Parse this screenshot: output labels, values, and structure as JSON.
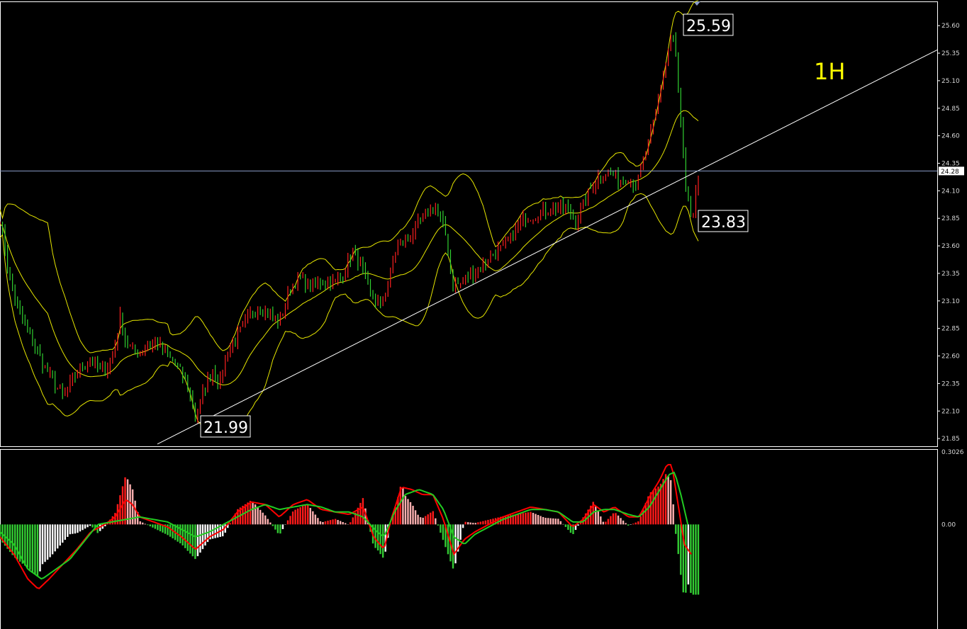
{
  "chart_data": {
    "type": "candlestick",
    "timeframe_label": "1H",
    "price_axis": {
      "ylim": [
        21.78,
        25.82
      ],
      "ticks": [
        "25.60",
        "25.35",
        "25.10",
        "24.85",
        "24.60",
        "24.35",
        "24.10",
        "23.85",
        "23.60",
        "23.35",
        "23.10",
        "22.85",
        "22.60",
        "22.35",
        "22.10",
        "21.85"
      ],
      "current_price_label": "24.28",
      "current_price": 24.28
    },
    "indicator_axis": {
      "ylim": [
        -0.42,
        0.3026
      ],
      "ticks": [
        "0.3026",
        "0.00"
      ],
      "zero_label": "0.00",
      "top_label": "0.3026"
    },
    "annotations": {
      "high": {
        "text": "25.59",
        "value": 25.59
      },
      "low": {
        "text": "21.99",
        "value": 21.99
      },
      "last": {
        "text": "23.83",
        "value": 23.83
      }
    },
    "bars_count": 280,
    "trendline": {
      "from": [
        0.163,
        21.8
      ],
      "to": [
        0.97,
        25.38
      ]
    },
    "colors": {
      "background": "#000000",
      "up": "#ff2020",
      "down": "#30d030",
      "bands": "#e6e600",
      "trendline": "#ffffff",
      "price_line": "#8a9bc8",
      "macd_line": "#ff0000",
      "signal_line": "#22cc22",
      "hist_pos_strong": "#ff1a1a",
      "hist_pos_weak": "#ffb0b0",
      "hist_neg_strong": "#33cc33",
      "hist_neg_weak": "#ffffff"
    },
    "price_path": [
      [
        0,
        23.85
      ],
      [
        0.006,
        23.62
      ],
      [
        0.015,
        23.25
      ],
      [
        0.03,
        22.95
      ],
      [
        0.045,
        22.75
      ],
      [
        0.06,
        22.55
      ],
      [
        0.075,
        22.38
      ],
      [
        0.09,
        22.22
      ],
      [
        0.102,
        22.35
      ],
      [
        0.115,
        22.5
      ],
      [
        0.13,
        22.55
      ],
      [
        0.145,
        22.45
      ],
      [
        0.16,
        22.55
      ],
      [
        0.172,
        22.95
      ],
      [
        0.18,
        22.72
      ],
      [
        0.195,
        22.62
      ],
      [
        0.21,
        22.7
      ],
      [
        0.225,
        22.72
      ],
      [
        0.24,
        22.6
      ],
      [
        0.255,
        22.5
      ],
      [
        0.27,
        22.3
      ],
      [
        0.28,
        22.02
      ],
      [
        0.292,
        22.3
      ],
      [
        0.305,
        22.48
      ],
      [
        0.315,
        22.35
      ],
      [
        0.325,
        22.62
      ],
      [
        0.34,
        22.78
      ],
      [
        0.355,
        22.95
      ],
      [
        0.37,
        23.05
      ],
      [
        0.385,
        22.98
      ],
      [
        0.4,
        22.9
      ],
      [
        0.415,
        23.2
      ],
      [
        0.43,
        23.32
      ],
      [
        0.445,
        23.22
      ],
      [
        0.46,
        23.28
      ],
      [
        0.475,
        23.25
      ],
      [
        0.49,
        23.32
      ],
      [
        0.505,
        23.55
      ],
      [
        0.518,
        23.4
      ],
      [
        0.53,
        23.15
      ],
      [
        0.545,
        23.05
      ],
      [
        0.555,
        23.25
      ],
      [
        0.568,
        23.6
      ],
      [
        0.58,
        23.65
      ],
      [
        0.595,
        23.75
      ],
      [
        0.61,
        23.9
      ],
      [
        0.625,
        23.95
      ],
      [
        0.638,
        23.7
      ],
      [
        0.648,
        23.25
      ],
      [
        0.66,
        23.25
      ],
      [
        0.675,
        23.35
      ],
      [
        0.69,
        23.42
      ],
      [
        0.705,
        23.52
      ],
      [
        0.72,
        23.58
      ],
      [
        0.735,
        23.7
      ],
      [
        0.75,
        23.85
      ],
      [
        0.765,
        23.88
      ],
      [
        0.78,
        23.92
      ],
      [
        0.795,
        23.95
      ],
      [
        0.81,
        23.95
      ],
      [
        0.825,
        23.82
      ],
      [
        0.84,
        24.05
      ],
      [
        0.855,
        24.22
      ],
      [
        0.87,
        24.28
      ],
      [
        0.885,
        24.2
      ],
      [
        0.9,
        24.22
      ],
      [
        0.912,
        24.15
      ],
      [
        0.925,
        24.45
      ],
      [
        0.935,
        24.7
      ],
      [
        0.945,
        25.0
      ],
      [
        0.955,
        25.3
      ],
      [
        0.962,
        25.55
      ],
      [
        0.968,
        25.3
      ],
      [
        0.975,
        24.7
      ],
      [
        0.982,
        24.1
      ],
      [
        0.988,
        23.9
      ],
      [
        0.992,
        23.85
      ],
      [
        0.996,
        24.05
      ],
      [
        1.0,
        24.15
      ]
    ],
    "macd_path": [
      [
        0,
        -0.05
      ],
      [
        0.02,
        -0.12
      ],
      [
        0.04,
        -0.22
      ],
      [
        0.055,
        -0.26
      ],
      [
        0.07,
        -0.22
      ],
      [
        0.09,
        -0.16
      ],
      [
        0.11,
        -0.1
      ],
      [
        0.13,
        -0.03
      ],
      [
        0.15,
        0.0
      ],
      [
        0.165,
        0.03
      ],
      [
        0.18,
        0.1
      ],
      [
        0.19,
        0.08
      ],
      [
        0.2,
        0.03
      ],
      [
        0.22,
        0.01
      ],
      [
        0.24,
        -0.01
      ],
      [
        0.26,
        -0.05
      ],
      [
        0.28,
        -0.1
      ],
      [
        0.3,
        -0.05
      ],
      [
        0.32,
        -0.02
      ],
      [
        0.34,
        0.05
      ],
      [
        0.36,
        0.09
      ],
      [
        0.38,
        0.08
      ],
      [
        0.4,
        0.03
      ],
      [
        0.42,
        0.08
      ],
      [
        0.44,
        0.1
      ],
      [
        0.46,
        0.06
      ],
      [
        0.48,
        0.05
      ],
      [
        0.5,
        0.04
      ],
      [
        0.52,
        0.07
      ],
      [
        0.535,
        -0.05
      ],
      [
        0.55,
        -0.1
      ],
      [
        0.56,
        0.02
      ],
      [
        0.575,
        0.15
      ],
      [
        0.59,
        0.14
      ],
      [
        0.605,
        0.12
      ],
      [
        0.62,
        0.12
      ],
      [
        0.635,
        0.02
      ],
      [
        0.65,
        -0.12
      ],
      [
        0.665,
        -0.06
      ],
      [
        0.68,
        -0.03
      ],
      [
        0.7,
        0.0
      ],
      [
        0.72,
        0.03
      ],
      [
        0.74,
        0.05
      ],
      [
        0.76,
        0.07
      ],
      [
        0.78,
        0.06
      ],
      [
        0.8,
        0.05
      ],
      [
        0.82,
        -0.01
      ],
      [
        0.835,
        0.02
      ],
      [
        0.85,
        0.08
      ],
      [
        0.865,
        0.05
      ],
      [
        0.88,
        0.07
      ],
      [
        0.9,
        0.03
      ],
      [
        0.915,
        0.03
      ],
      [
        0.93,
        0.11
      ],
      [
        0.945,
        0.18
      ],
      [
        0.955,
        0.24
      ],
      [
        0.962,
        0.24
      ],
      [
        0.97,
        0.1
      ],
      [
        0.98,
        -0.08
      ],
      [
        0.99,
        -0.12
      ]
    ],
    "signal_path": [
      [
        0,
        -0.03
      ],
      [
        0.02,
        -0.08
      ],
      [
        0.04,
        -0.18
      ],
      [
        0.06,
        -0.22
      ],
      [
        0.08,
        -0.18
      ],
      [
        0.1,
        -0.14
      ],
      [
        0.12,
        -0.07
      ],
      [
        0.14,
        0.0
      ],
      [
        0.16,
        0.01
      ],
      [
        0.18,
        0.02
      ],
      [
        0.2,
        0.03
      ],
      [
        0.22,
        0.02
      ],
      [
        0.24,
        0.01
      ],
      [
        0.26,
        -0.02
      ],
      [
        0.28,
        -0.05
      ],
      [
        0.3,
        -0.03
      ],
      [
        0.32,
        0.0
      ],
      [
        0.34,
        0.03
      ],
      [
        0.36,
        0.06
      ],
      [
        0.38,
        0.08
      ],
      [
        0.4,
        0.06
      ],
      [
        0.42,
        0.07
      ],
      [
        0.44,
        0.08
      ],
      [
        0.46,
        0.07
      ],
      [
        0.48,
        0.05
      ],
      [
        0.5,
        0.05
      ],
      [
        0.52,
        0.03
      ],
      [
        0.54,
        -0.03
      ],
      [
        0.55,
        -0.05
      ],
      [
        0.565,
        0.05
      ],
      [
        0.58,
        0.12
      ],
      [
        0.6,
        0.14
      ],
      [
        0.62,
        0.12
      ],
      [
        0.635,
        0.06
      ],
      [
        0.65,
        -0.05
      ],
      [
        0.665,
        -0.08
      ],
      [
        0.68,
        -0.04
      ],
      [
        0.7,
        -0.01
      ],
      [
        0.72,
        0.02
      ],
      [
        0.74,
        0.04
      ],
      [
        0.76,
        0.06
      ],
      [
        0.78,
        0.06
      ],
      [
        0.8,
        0.05
      ],
      [
        0.82,
        0.01
      ],
      [
        0.835,
        0.01
      ],
      [
        0.85,
        0.05
      ],
      [
        0.865,
        0.06
      ],
      [
        0.88,
        0.06
      ],
      [
        0.9,
        0.04
      ],
      [
        0.915,
        0.03
      ],
      [
        0.93,
        0.07
      ],
      [
        0.945,
        0.14
      ],
      [
        0.958,
        0.2
      ],
      [
        0.966,
        0.21
      ],
      [
        0.975,
        0.12
      ],
      [
        0.985,
        0.0
      ]
    ]
  }
}
